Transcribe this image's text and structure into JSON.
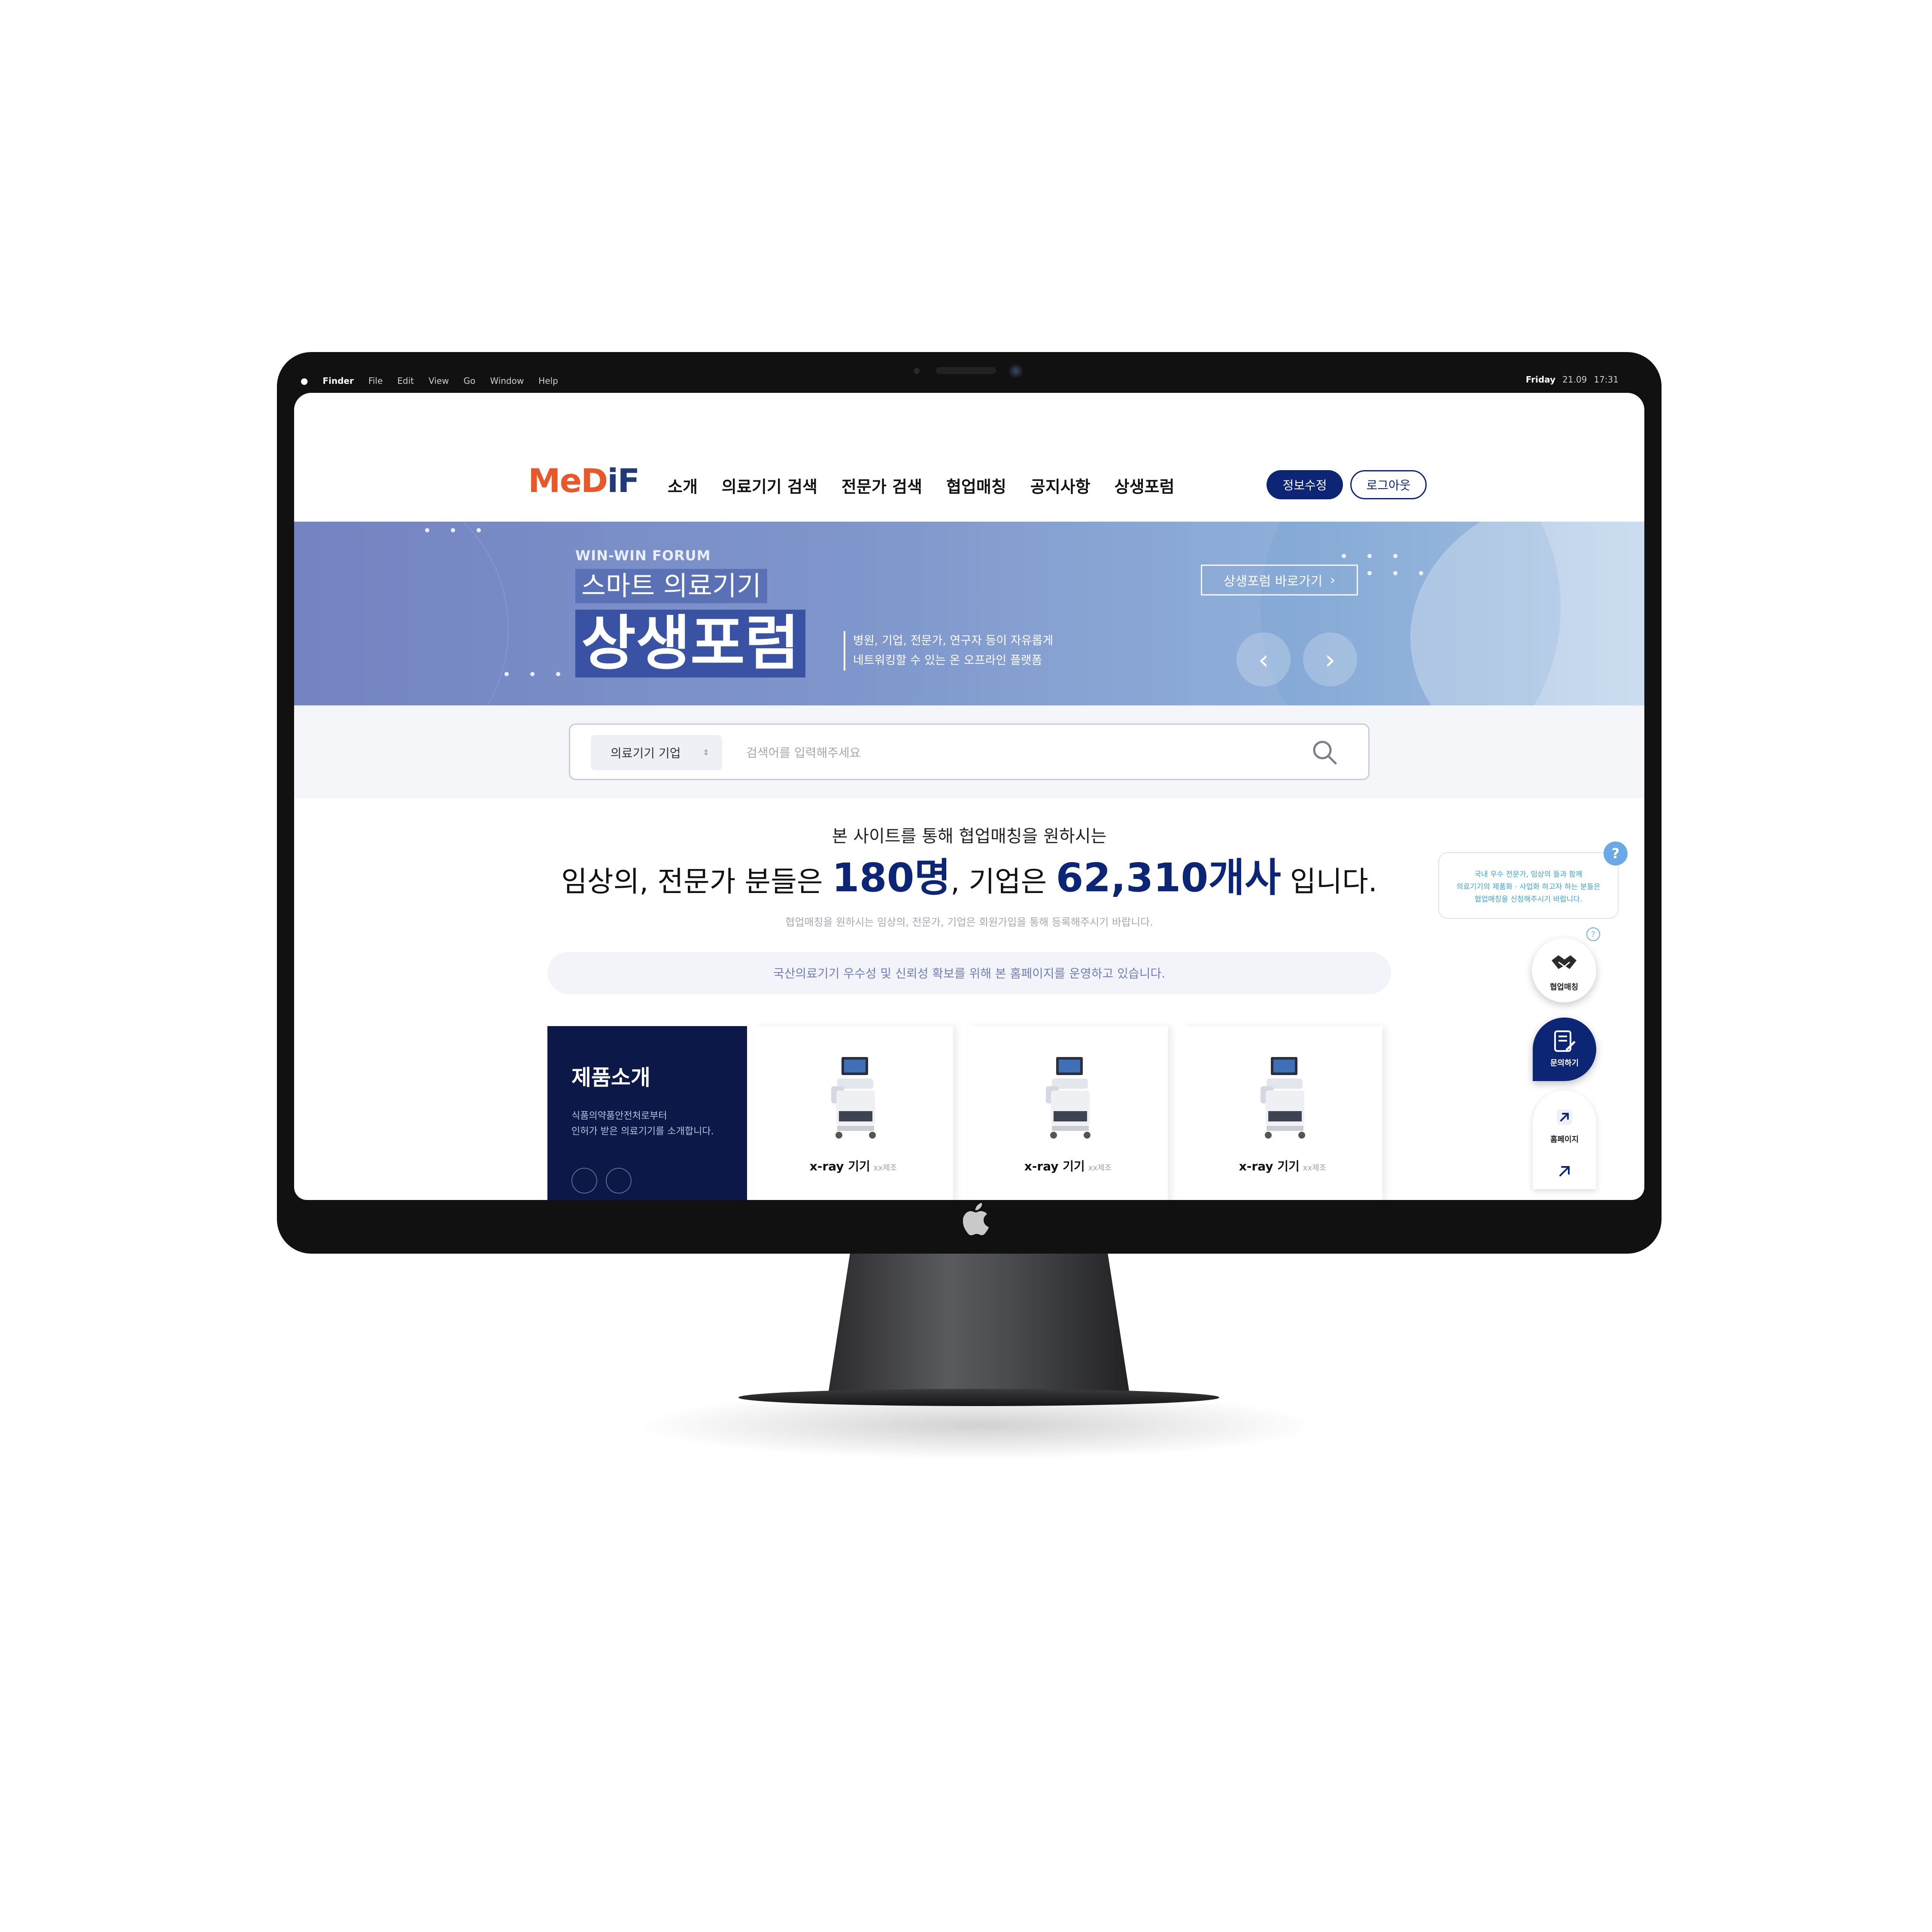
{
  "menubar": {
    "items": [
      "Finder",
      "File",
      "Edit",
      "View",
      "Go",
      "Window",
      "Help"
    ],
    "day": "Friday",
    "date": "21.09",
    "time": "17:31"
  },
  "header": {
    "logo_part1": "MeD",
    "logo_part2": "iF",
    "nav": [
      "소개",
      "의료기기 검색",
      "전문가 검색",
      "협업매칭",
      "공지사항",
      "상생포럼"
    ],
    "edit_label": "정보수정",
    "logout_label": "로그아웃"
  },
  "banner": {
    "kicker": "WIN-WIN FORUM",
    "line1": "스마트 의료기기",
    "line2": "상생포럼",
    "desc_line1": "병원, 기업, 전문가, 연구자 등이 자유롭게",
    "desc_line2": "네트워킹할 수 있는 온 오프라인 플랫폼",
    "cta_label": "상생포럼 바로가기",
    "cta_arrow": "›",
    "prev_arrow": "‹",
    "next_arrow": "›"
  },
  "search": {
    "category": "의료기기 기업",
    "caret": "⇕",
    "placeholder": "검색어를 입력해주세요"
  },
  "stats": {
    "lead": "본 사이트를 통해 협업매칭을 원하시는",
    "part1": "임상의, 전문가 분들은 ",
    "experts": "180명",
    "part2": ", 기업은 ",
    "companies": "62,310개사",
    "part3": " 입니다.",
    "sub": "협업매칭을 원하시는 임상의, 전문가, 기업은 회원가입을 통해 등록해주시기 바랍니다.",
    "notice": "국산의료기기 우수성 및 신뢰성 확보를 위해 본 홈페이지를 운영하고 있습니다."
  },
  "products": {
    "intro_title": "제품소개",
    "intro_desc_line1": "식품의약품안전처로부터",
    "intro_desc_line2": "인허가 받은 의료기기를 소개합니다.",
    "items": [
      {
        "name": "x-ray 기기",
        "maker": "xx제조"
      },
      {
        "name": "x-ray 기기",
        "maker": "xx제조"
      },
      {
        "name": "x-ray 기기",
        "maker": "xx제조"
      }
    ]
  },
  "widgets": {
    "help_line1": "국내 우수 전문가, 임상의 들과 함께",
    "help_line2": "의료기기의 제품화 · 사업화 하고자 하는 분들은",
    "help_line3": "협업매칭을 신청해주시기 바랍니다.",
    "help_q": "?",
    "match_q": "?",
    "match_label": "협업매칭",
    "inquiry_label": "문의하기",
    "home_label": "홈페이지"
  },
  "colors": {
    "brand_navy": "#0d2575",
    "logo_orange": "#e7592a",
    "logo_navy": "#223a77",
    "banner_blue": "#7e95cb"
  }
}
